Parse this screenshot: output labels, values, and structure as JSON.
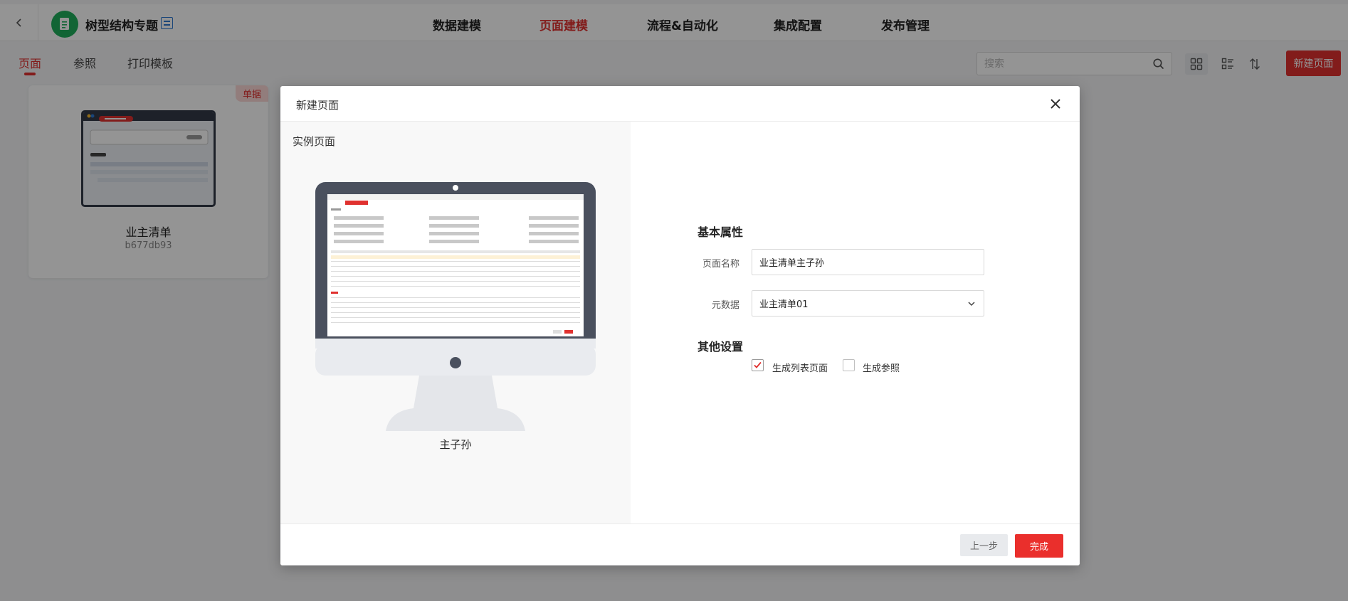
{
  "app": {
    "title": "树型结构专题"
  },
  "nav": {
    "items": [
      {
        "label": "数据建模",
        "active": false
      },
      {
        "label": "页面建模",
        "active": true
      },
      {
        "label": "流程&自动化",
        "active": false
      },
      {
        "label": "集成配置",
        "active": false
      },
      {
        "label": "发布管理",
        "active": false
      }
    ]
  },
  "tabs": [
    {
      "label": "页面",
      "active": true
    },
    {
      "label": "参照",
      "active": false
    },
    {
      "label": "打印模板",
      "active": false
    }
  ],
  "search": {
    "placeholder": "搜索"
  },
  "toolbar": {
    "new_page_label": "新建页面"
  },
  "card": {
    "badge": "单据",
    "title": "业主清单",
    "code": "b677db93"
  },
  "modal": {
    "title": "新建页面",
    "left_pane_label": "实例页面",
    "preview_caption": "主子孙",
    "basic_section": "基本属性",
    "page_name_label": "页面名称",
    "page_name_value": "业主清单主子孙",
    "metadata_label": "元数据",
    "metadata_value": "业主清单01",
    "other_section": "其他设置",
    "options": [
      {
        "label": "生成列表页面",
        "checked": true
      },
      {
        "label": "生成参照",
        "checked": false
      }
    ],
    "prev_label": "上一步",
    "done_label": "完成"
  },
  "colors": {
    "accent": "#e0312f",
    "app_logo": "#1fae5c",
    "monitor_frame": "#4a505e"
  }
}
